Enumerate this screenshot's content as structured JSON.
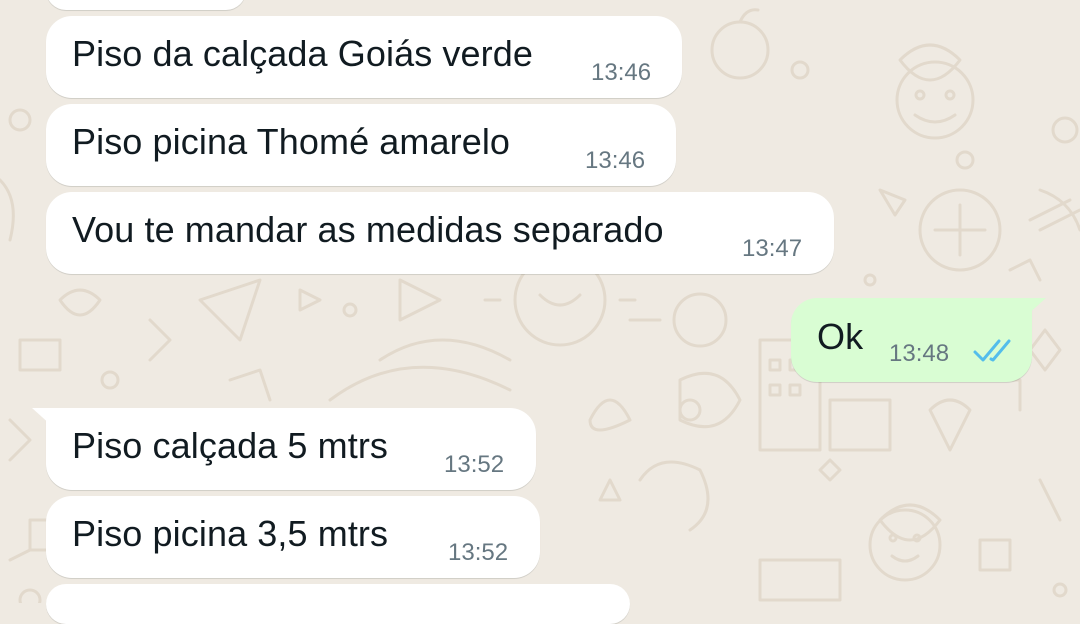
{
  "theme": {
    "chat_background": "#efeae2",
    "incoming_bubble": "#ffffff",
    "outgoing_bubble": "#d9fdd3",
    "read_receipt_color": "#53bdeb",
    "timestamp_color": "#667781"
  },
  "messages": [
    {
      "direction": "in",
      "text": "Piso da calçada Goiás verde",
      "time": "13:46"
    },
    {
      "direction": "in",
      "text": "Piso picina Thomé amarelo",
      "time": "13:46"
    },
    {
      "direction": "in",
      "text": "Vou te mandar as medidas separado",
      "time": "13:47"
    },
    {
      "direction": "out",
      "text": "Ok",
      "time": "13:48",
      "status": "read",
      "status_icon": "double-check-icon"
    },
    {
      "direction": "in",
      "text": "Piso calçada 5 mtrs",
      "time": "13:52"
    },
    {
      "direction": "in",
      "text": "Piso picina 3,5 mtrs",
      "time": "13:52"
    }
  ]
}
